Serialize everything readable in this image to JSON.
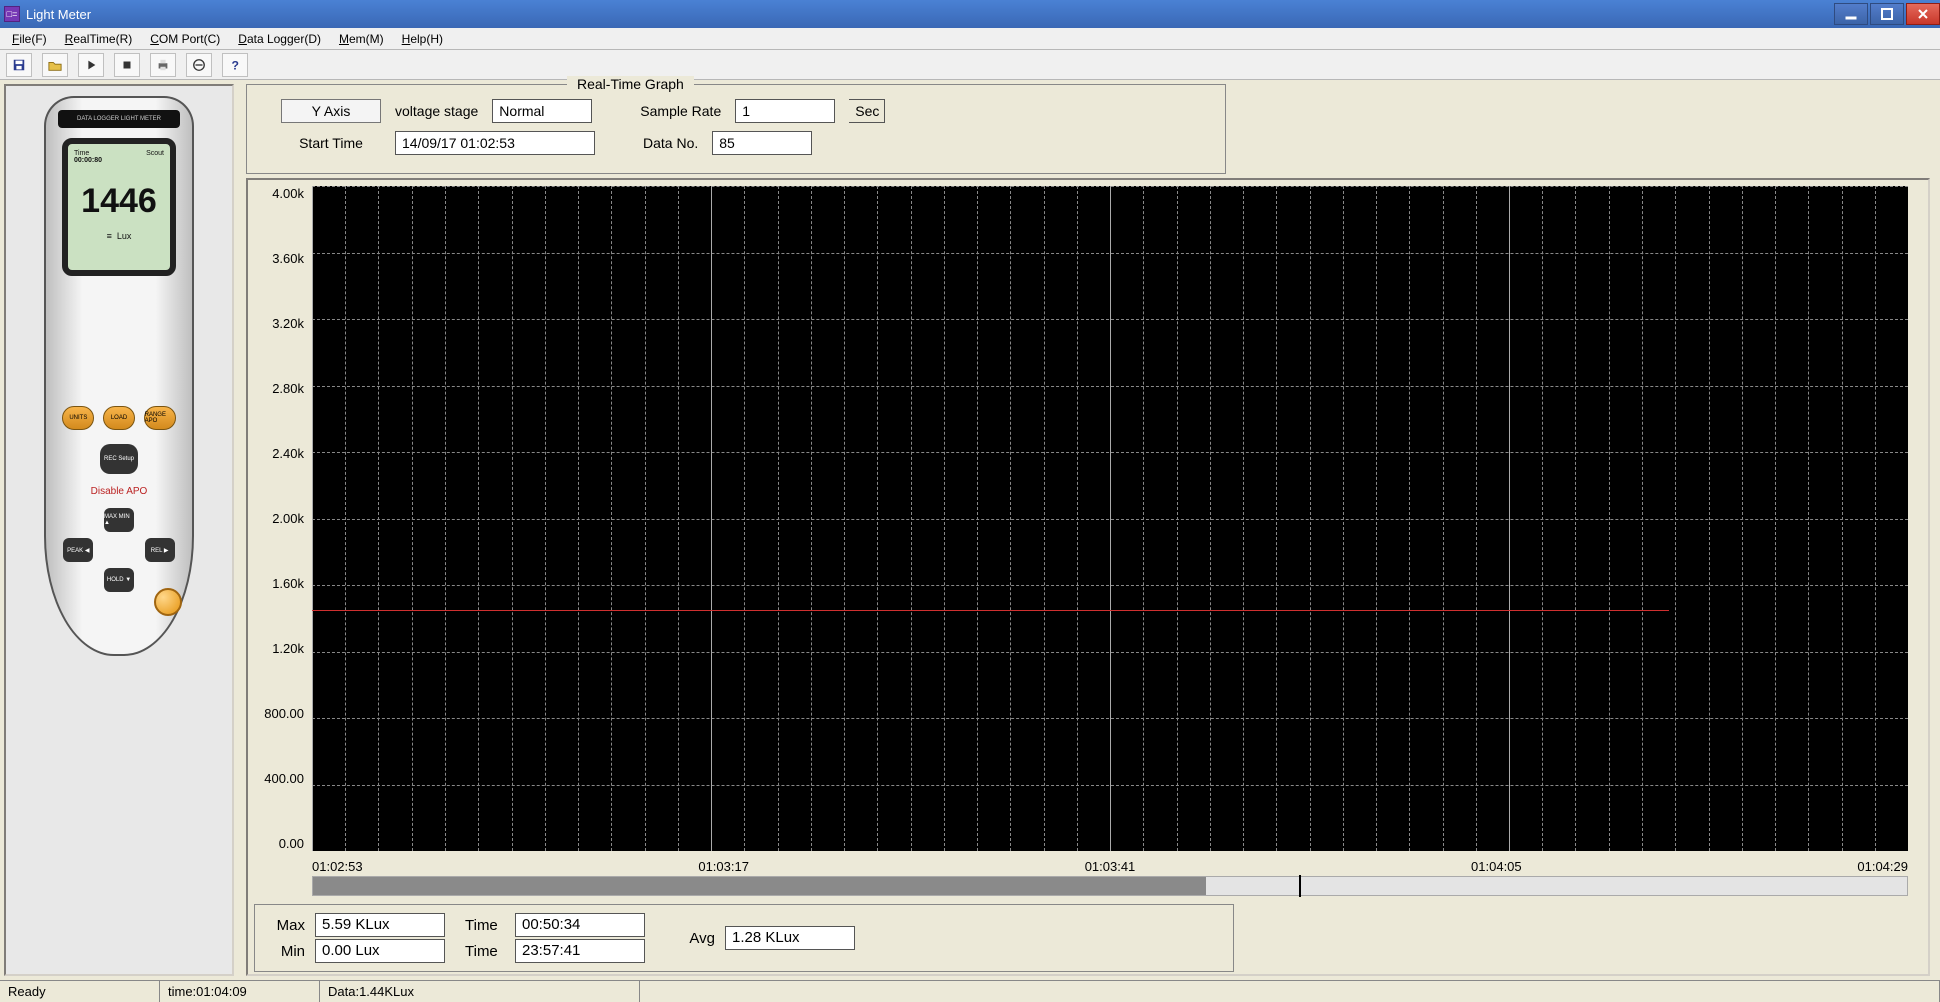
{
  "window": {
    "title": "Light Meter"
  },
  "menu": {
    "file": "File(F)",
    "realtime": "RealTime(R)",
    "comport": "COM Port(C)",
    "datalogger": "Data Logger(D)",
    "mem": "Mem(M)",
    "help": "Help(H)"
  },
  "device": {
    "label_bar": "DATA LOGGER LIGHT METER",
    "time_label": "Time",
    "time_value": "00:00:80",
    "mode": "Scout",
    "reading": "1446",
    "unit": "Lux",
    "btn_units": "UNITS",
    "btn_load": "LOAD",
    "btn_range": "RANGE APO",
    "btn_rec": "REC Setup",
    "btn_maxmin": "MAX MIN ▲",
    "btn_peak": "PEAK ◀",
    "btn_rel": "REL ▶",
    "btn_hold": "HOLD ▼",
    "disable": "Disable APO"
  },
  "group": {
    "legend": "Real-Time    Graph",
    "yaxis_btn": "Y Axis",
    "voltage_label": "voltage stage",
    "voltage_value": "Normal",
    "sample_label": "Sample Rate",
    "sample_value": "1",
    "sample_unit": "Sec",
    "start_label": "Start Time",
    "start_value": "14/09/17 01:02:53",
    "datano_label": "Data No.",
    "datano_value": "85"
  },
  "chart_data": {
    "type": "line",
    "title": "",
    "ylabel": "",
    "xlabel": "",
    "y_ticks": [
      "4.00k",
      "3.60k",
      "3.20k",
      "2.80k",
      "2.40k",
      "2.00k",
      "1.60k",
      "1.20k",
      "800.00",
      "400.00",
      "0.00"
    ],
    "x_ticks": [
      "01:02:53",
      "01:03:17",
      "01:03:41",
      "01:04:05",
      "01:04:29"
    ],
    "ylim": [
      0,
      4000
    ],
    "series": [
      {
        "name": "Lux",
        "color": "#d03030",
        "approx_constant_value": 1450,
        "x_extent_fraction": 0.85
      }
    ]
  },
  "stats": {
    "max_label": "Max",
    "max_value": "5.59  KLux",
    "max_time_label": "Time",
    "max_time": "00:50:34",
    "min_label": "Min",
    "min_value": "0.00  Lux",
    "min_time_label": "Time",
    "min_time": "23:57:41",
    "avg_label": "Avg",
    "avg_value": "1.28  KLux"
  },
  "status": {
    "ready": "Ready",
    "time": "time:01:04:09",
    "data": "Data:1.44KLux"
  }
}
